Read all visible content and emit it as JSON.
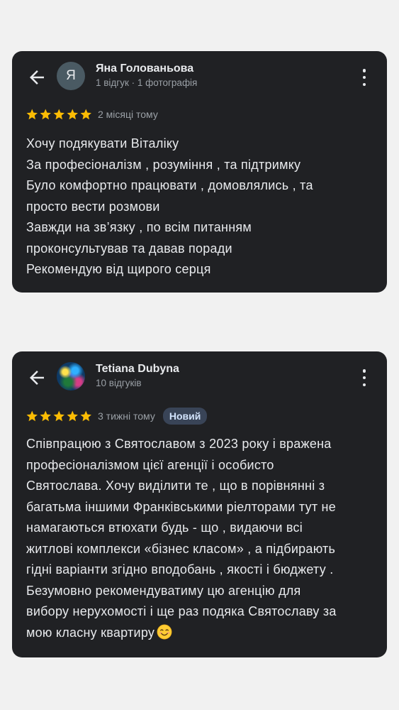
{
  "reviews": [
    {
      "author": "Яна Голованьова",
      "avatar_letter": "Я",
      "meta": "1 відгук · 1 фотографія",
      "rating": 5,
      "time": "2 місяці тому",
      "badge": "",
      "text_lines": [
        "Хочу подякувати Віталіку",
        "За професіоналізм , розуміння , та підтримку",
        "Було комфортно працювати , домовлялись , та",
        "просто вести розмови",
        "Завжди на зв’язку , по всім питанням",
        "проконсультував та давав поради",
        "Рекомендую від щирого серця"
      ]
    },
    {
      "author": "Tetiana Dubyna",
      "meta": "10 відгуків",
      "rating": 5,
      "time": "3 тижні тому",
      "badge": "Новий",
      "text_lines": [
        "Співпрацюю з Святославом з 2023 року і вражена",
        "професіоналізмом цієї агенції і особисто",
        "Святослава. Хочу виділити те , що в порівнянні з",
        "багатьма іншими Франківськими ріелторами тут не",
        "намагаються втюхати будь - що , видаючи всі",
        "житлові комплекси «бізнес класом» , а підбирають",
        "гідні варіанти згідно вподобань , якості і бюджету .",
        "Безумовно рекомендуватиму цю агенцію для",
        "вибору нерухомості і ще раз подяка Святославу за",
        "мою класну квартиру"
      ],
      "trailing_icon": "smiling-face-emoji"
    }
  ],
  "icons": {
    "back": "arrow-back-icon",
    "more": "more-vert-icon",
    "star": "star-icon"
  },
  "colors": {
    "card_background": "#202124",
    "page_background": "#f1f1f1",
    "star": "#fbbc04",
    "badge_background": "#394457",
    "badge_text": "#d2e3fc"
  }
}
